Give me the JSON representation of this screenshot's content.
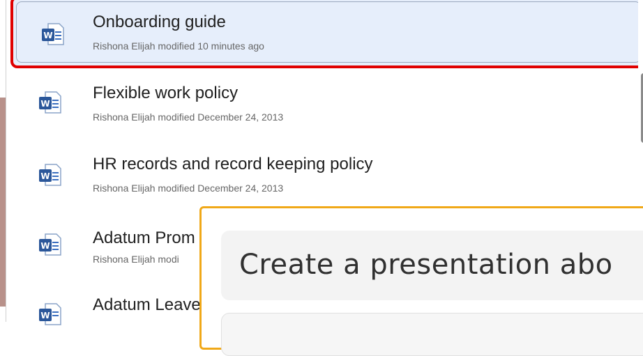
{
  "documents": [
    {
      "title": "Onboarding guide",
      "subtitle": "Rishona Elijah modified 10 minutes ago",
      "icon": "word-doc-icon",
      "selected": true
    },
    {
      "title": "Flexible work policy",
      "subtitle": "Rishona Elijah modified December 24, 2013",
      "icon": "word-doc-icon"
    },
    {
      "title": "HR records and record keeping policy",
      "subtitle": "Rishona Elijah modified December 24, 2013",
      "icon": "word-doc-icon"
    },
    {
      "title": "Adatum Prom",
      "subtitle": "Rishona Elijah modi",
      "icon": "word-doc-icon"
    },
    {
      "title": "Adatum Leave",
      "subtitle": "",
      "icon": "word-doc-icon"
    }
  ],
  "popup": {
    "prompt": "Create a presentation abo"
  },
  "colors": {
    "selection_outline": "#e00000",
    "popup_outline": "#f0a818",
    "word_blue": "#2b579a"
  }
}
